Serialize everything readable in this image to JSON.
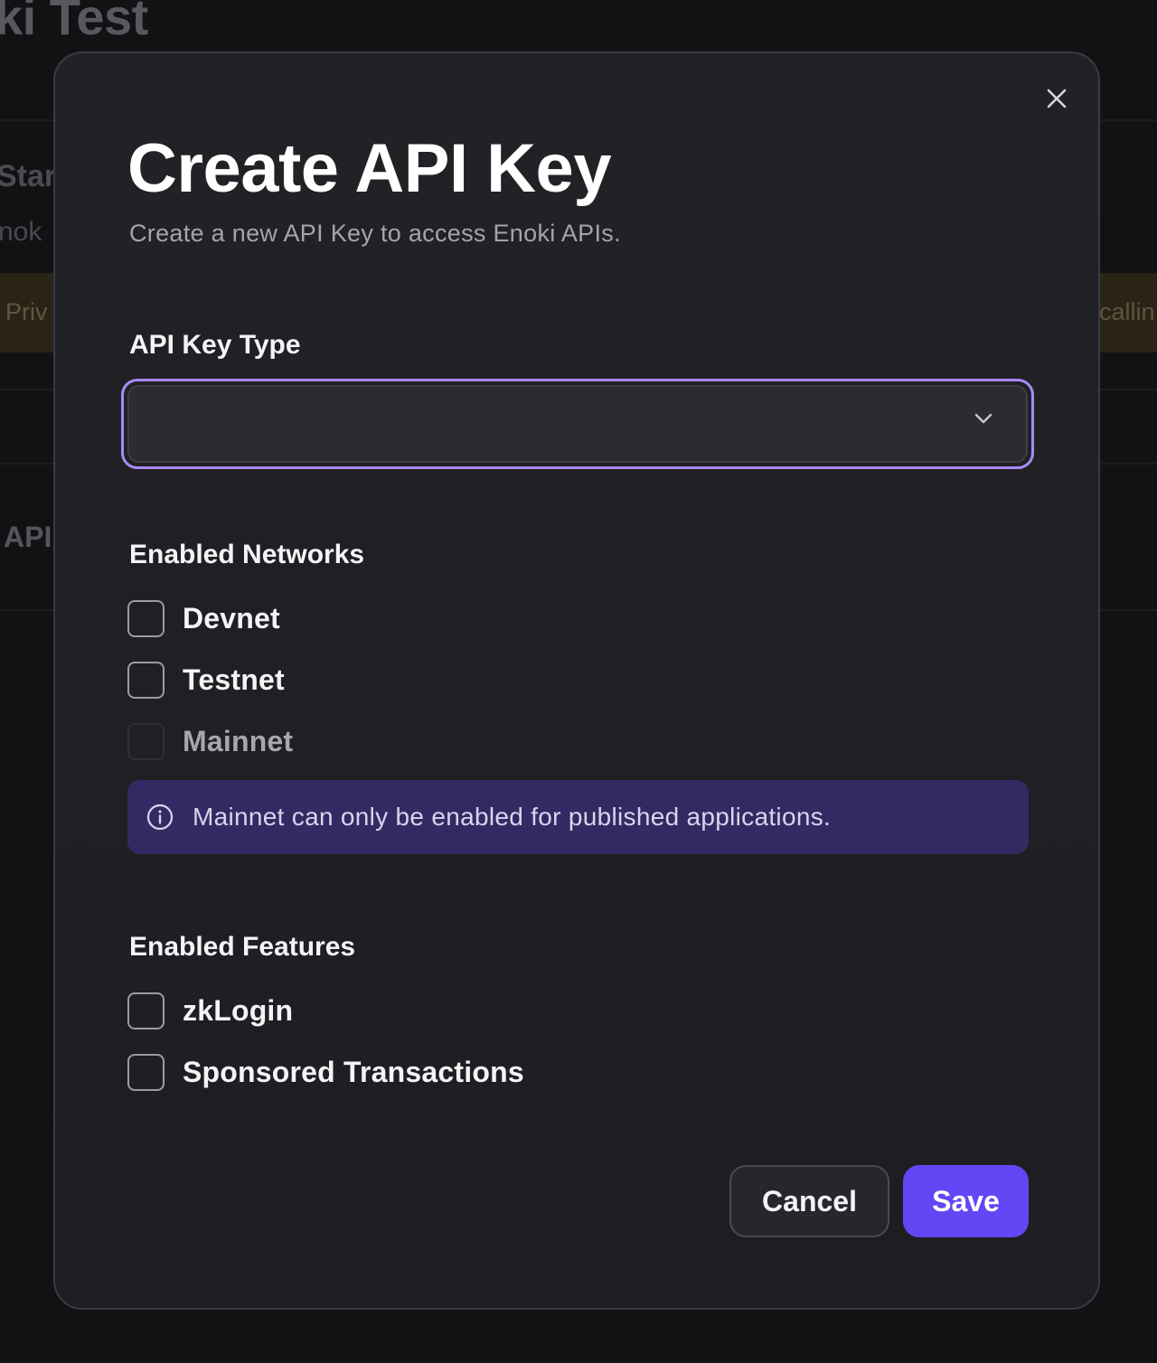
{
  "background": {
    "page_title": "ki Test",
    "start_heading": "Star",
    "start_text": "nok",
    "warning_left": "Priv",
    "warning_right": "callin",
    "api_heading": "API"
  },
  "modal": {
    "title": "Create API Key",
    "subtitle": "Create a new API Key to access Enoki APIs.",
    "close_icon": "close-icon",
    "api_key_type": {
      "label": "API Key Type",
      "value": "",
      "icon": "chevron-down-icon"
    },
    "networks": {
      "label": "Enabled Networks",
      "items": [
        {
          "label": "Devnet",
          "checked": false,
          "disabled": false
        },
        {
          "label": "Testnet",
          "checked": false,
          "disabled": false
        },
        {
          "label": "Mainnet",
          "checked": false,
          "disabled": true
        }
      ],
      "info": {
        "icon": "info-icon",
        "text": "Mainnet can only be enabled for published applications."
      }
    },
    "features": {
      "label": "Enabled Features",
      "items": [
        {
          "label": "zkLogin",
          "checked": false
        },
        {
          "label": "Sponsored Transactions",
          "checked": false
        }
      ]
    },
    "actions": {
      "cancel_label": "Cancel",
      "save_label": "Save"
    }
  },
  "colors": {
    "accent": "#6247f5",
    "focus_ring": "#a78bfa",
    "info_background": "#342a63",
    "modal_background": "#222226"
  }
}
